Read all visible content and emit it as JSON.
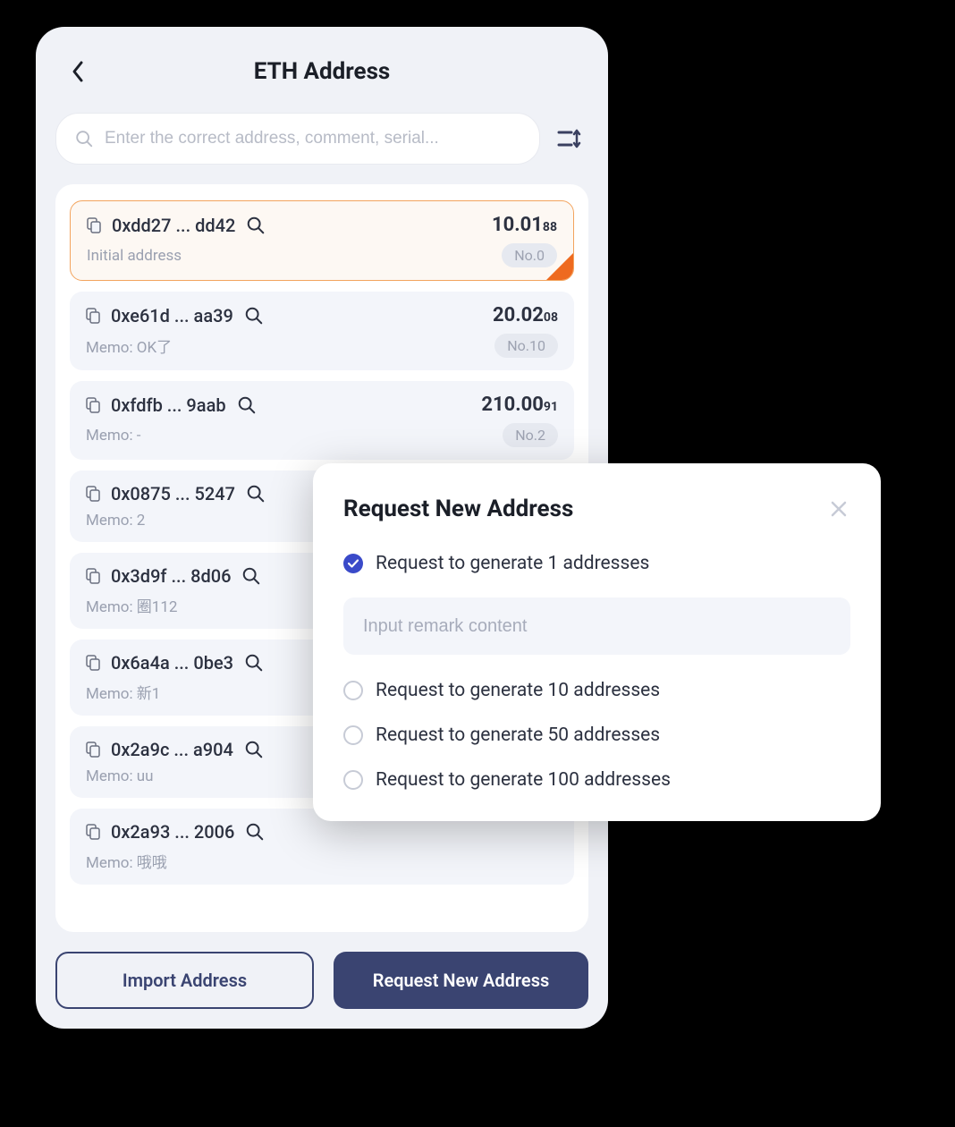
{
  "header": {
    "title": "ETH Address"
  },
  "search": {
    "placeholder": "Enter the correct address, comment, serial..."
  },
  "addresses": [
    {
      "addr": "0xdd27 ... dd42",
      "balance_main": "10.01",
      "balance_sub": "88",
      "memo": "Initial address",
      "badge": "No.0",
      "selected": true
    },
    {
      "addr": "0xe61d ... aa39",
      "balance_main": "20.02",
      "balance_sub": "08",
      "memo": "Memo: OK了",
      "badge": "No.10",
      "selected": false
    },
    {
      "addr": "0xfdfb ... 9aab",
      "balance_main": "210.00",
      "balance_sub": "91",
      "memo": "Memo: -",
      "badge": "No.2",
      "selected": false
    },
    {
      "addr": "0x0875 ... 5247",
      "balance_main": "",
      "balance_sub": "",
      "memo": "Memo: 2",
      "badge": "",
      "selected": false
    },
    {
      "addr": "0x3d9f ... 8d06",
      "balance_main": "",
      "balance_sub": "",
      "memo": "Memo: 圈112",
      "badge": "",
      "selected": false
    },
    {
      "addr": "0x6a4a ... 0be3",
      "balance_main": "",
      "balance_sub": "",
      "memo": "Memo: 新1",
      "badge": "",
      "selected": false
    },
    {
      "addr": "0x2a9c ... a904",
      "balance_main": "",
      "balance_sub": "",
      "memo": "Memo: uu",
      "badge": "",
      "selected": false
    },
    {
      "addr": "0x2a93 ... 2006",
      "balance_main": "",
      "balance_sub": "",
      "memo": "Memo: 哦哦",
      "badge": "",
      "selected": false
    }
  ],
  "buttons": {
    "import": "Import Address",
    "request": "Request New Address"
  },
  "modal": {
    "title": "Request New Address",
    "options": [
      {
        "label": "Request to generate 1 addresses",
        "checked": true
      },
      {
        "label": "Request to generate 10 addresses",
        "checked": false
      },
      {
        "label": "Request to generate 50 addresses",
        "checked": false
      },
      {
        "label": "Request to generate 100 addresses",
        "checked": false
      }
    ],
    "remark_placeholder": "Input remark content"
  }
}
